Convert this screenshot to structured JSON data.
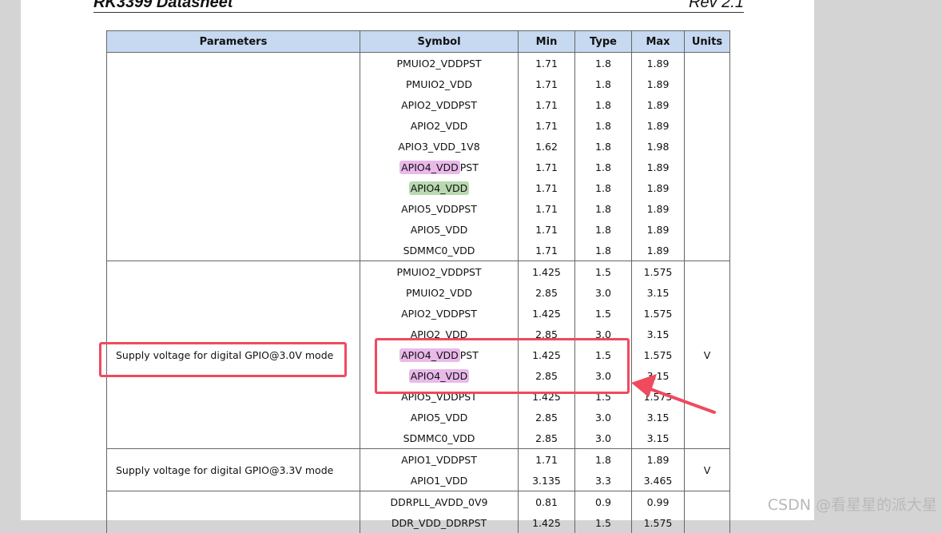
{
  "header": {
    "title": "RK3399 Datasheet",
    "revision": "Rev 2.1"
  },
  "columns": [
    "Parameters",
    "Symbol",
    "Min",
    "Type",
    "Max",
    "Units"
  ],
  "groups": [
    {
      "parameter": "",
      "units": "",
      "rows": [
        {
          "symbol": "PMUIO2_VDDPST",
          "min": "1.71",
          "type": "1.8",
          "max": "1.89"
        },
        {
          "symbol": "PMUIO2_VDD",
          "min": "1.71",
          "type": "1.8",
          "max": "1.89"
        },
        {
          "symbol": "APIO2_VDDPST",
          "min": "1.71",
          "type": "1.8",
          "max": "1.89"
        },
        {
          "symbol": "APIO2_VDD",
          "min": "1.71",
          "type": "1.8",
          "max": "1.89"
        },
        {
          "symbol": "APIO3_VDD_1V8",
          "min": "1.62",
          "type": "1.8",
          "max": "1.98"
        },
        {
          "symbol": "APIO4_VDDPST",
          "min": "1.71",
          "type": "1.8",
          "max": "1.89",
          "hl": "pink",
          "hl_part": "APIO4_VDD",
          "rest": "PST"
        },
        {
          "symbol": "APIO4_VDD",
          "min": "1.71",
          "type": "1.8",
          "max": "1.89",
          "hl": "green",
          "hl_part": "APIO4_VDD",
          "rest": ""
        },
        {
          "symbol": "APIO5_VDDPST",
          "min": "1.71",
          "type": "1.8",
          "max": "1.89"
        },
        {
          "symbol": "APIO5_VDD",
          "min": "1.71",
          "type": "1.8",
          "max": "1.89"
        },
        {
          "symbol": "SDMMC0_VDD",
          "min": "1.71",
          "type": "1.8",
          "max": "1.89"
        }
      ]
    },
    {
      "parameter": "Supply voltage for digital GPIO@3.0V mode",
      "units": "V",
      "rows": [
        {
          "symbol": "PMUIO2_VDDPST",
          "min": "1.425",
          "type": "1.5",
          "max": "1.575"
        },
        {
          "symbol": "PMUIO2_VDD",
          "min": "2.85",
          "type": "3.0",
          "max": "3.15"
        },
        {
          "symbol": "APIO2_VDDPST",
          "min": "1.425",
          "type": "1.5",
          "max": "1.575"
        },
        {
          "symbol": "APIO2_VDD",
          "min": "2.85",
          "type": "3.0",
          "max": "3.15"
        },
        {
          "symbol": "APIO4_VDDPST",
          "min": "1.425",
          "type": "1.5",
          "max": "1.575",
          "hl": "pink",
          "hl_part": "APIO4_VDD",
          "rest": "PST"
        },
        {
          "symbol": "APIO4_VDD",
          "min": "2.85",
          "type": "3.0",
          "max": "3.15",
          "hl": "pink",
          "hl_part": "APIO4_VDD",
          "rest": ""
        },
        {
          "symbol": "APIO5_VDDPST",
          "min": "1.425",
          "type": "1.5",
          "max": "1.575"
        },
        {
          "symbol": "APIO5_VDD",
          "min": "2.85",
          "type": "3.0",
          "max": "3.15"
        },
        {
          "symbol": "SDMMC0_VDD",
          "min": "2.85",
          "type": "3.0",
          "max": "3.15"
        }
      ]
    },
    {
      "parameter": "Supply voltage for digital GPIO@3.3V mode",
      "units": "V",
      "rows": [
        {
          "symbol": "APIO1_VDDPST",
          "min": "1.71",
          "type": "1.8",
          "max": "1.89"
        },
        {
          "symbol": "APIO1_VDD",
          "min": "3.135",
          "type": "3.3",
          "max": "3.465"
        }
      ]
    },
    {
      "parameter": "",
      "units": "",
      "rows": [
        {
          "symbol": "DDRPLL_AVDD_0V9",
          "min": "0.81",
          "type": "0.9",
          "max": "0.99"
        },
        {
          "symbol": "DDR_VDD_DDRPST",
          "min": "1.425",
          "type": "1.5",
          "max": "1.575"
        }
      ]
    }
  ],
  "watermark": "CSDN @看星星的派大星",
  "colors": {
    "header_bg": "#c6d9f1",
    "annotation": "#ef4a5e",
    "pink_highlight": "#e9b9ea",
    "green_highlight": "#b9d9b0"
  }
}
